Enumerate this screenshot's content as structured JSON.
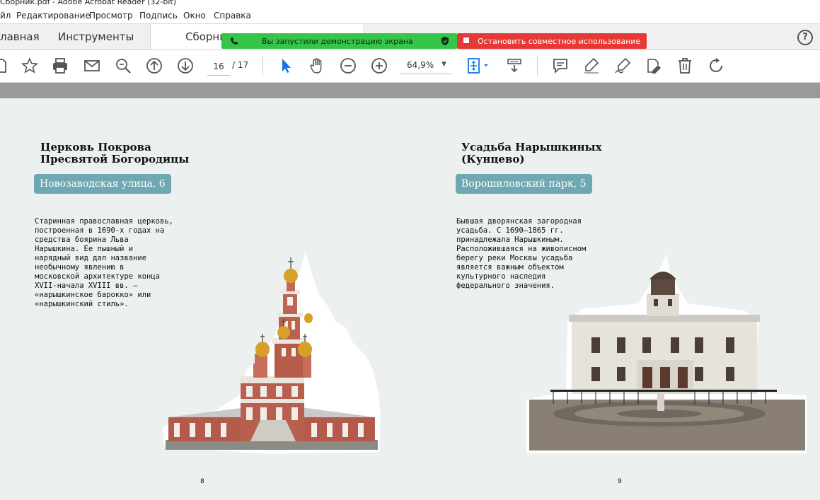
{
  "window": {
    "title": "Сборник.pdf - Adobe Acrobat Reader (32-bit)"
  },
  "menu": {
    "items": [
      "йл",
      "Редактирование",
      "Просмотр",
      "Подпись",
      "Окно",
      "Справка"
    ]
  },
  "tabs": {
    "home": "лавная",
    "tools": "Инструменты",
    "document": "Сборни"
  },
  "share_banner": {
    "status": "Вы запустили демонстрацию экрана",
    "stop": "Остановить совместное использование"
  },
  "toolbar": {
    "current_page": "16",
    "total_pages": "/ 17",
    "zoom": "64,9%"
  },
  "doc": {
    "left": {
      "title_lines": [
        "Церковь Покрова",
        "Пресвятой Богородицы"
      ],
      "address": "Новозаводская улица, 6",
      "description_lines": [
        "Старинная православная церковь,",
        "построенная в 1690-х годах на",
        "средства боярина Льва",
        "Нарышкина. Ее пышный и",
        "нарядный вид дал название",
        "необычному явлению в",
        "московской архитектуре конца",
        "XVII-начала XVIII вв. –",
        "«нарышкинское барокко» или",
        "«нарышкинский стиль»."
      ],
      "page_number": "8"
    },
    "right": {
      "title_lines": [
        "Усадьба Нарышкиных",
        "(Кунцево)"
      ],
      "address": "Ворошиловский парк, 5",
      "description_lines": [
        "Бывшая дворянская загородная",
        "усадьба. С 1690—1865 гг.",
        "принадлежала Нарышкиным.",
        "Расположившаяся на живописном",
        "берегу реки Москвы усадьба",
        "является важным объектом",
        "культурного наследия",
        "федерального значения."
      ],
      "page_number": "9"
    }
  },
  "colors": {
    "share_green": "#36c548",
    "share_red": "#e53935",
    "badge_teal": "#6fa7b2",
    "page_bg": "#ecf0ef",
    "select_tool_blue": "#1473e6"
  },
  "icons": [
    "save-icon",
    "star-icon",
    "print-icon",
    "mail-icon",
    "zoom-search-icon",
    "page-up-icon",
    "page-down-icon",
    "select-cursor-icon",
    "hand-icon",
    "zoom-out-icon",
    "zoom-in-icon",
    "fit-page-icon",
    "scroll-mode-icon",
    "comment-icon",
    "highlight-icon",
    "sign-icon",
    "edit-pdf-icon",
    "delete-icon",
    "rotate-icon",
    "help-icon",
    "phone-icon",
    "shield-check-icon",
    "stop-icon"
  ]
}
